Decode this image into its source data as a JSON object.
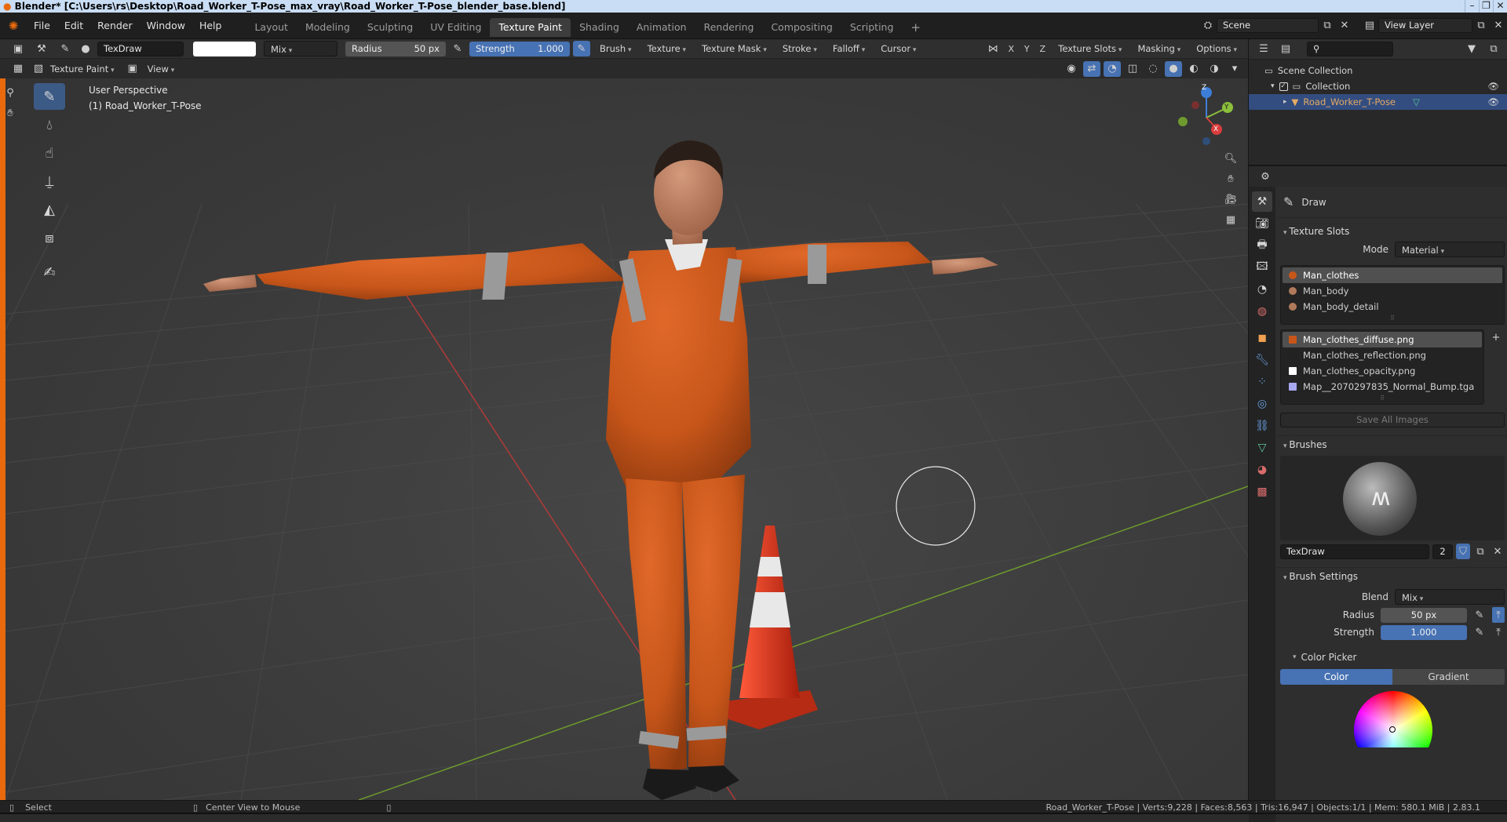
{
  "window": {
    "title": "Blender* [C:\\Users\\rs\\Desktop\\Road_Worker_T-Pose_max_vray\\Road_Worker_T-Pose_blender_base.blend]"
  },
  "menu": [
    "File",
    "Edit",
    "Render",
    "Window",
    "Help"
  ],
  "workspaces": [
    "Layout",
    "Modeling",
    "Sculpting",
    "UV Editing",
    "Texture Paint",
    "Shading",
    "Animation",
    "Rendering",
    "Compositing",
    "Scripting"
  ],
  "active_workspace": "Texture Paint",
  "scene": {
    "label": "Scene",
    "view_layer": "View Layer"
  },
  "toolheader": {
    "brush_name": "TexDraw",
    "blend": "Mix",
    "radius_label": "Radius",
    "radius_value": "50 px",
    "strength_label": "Strength",
    "strength_value": "1.000",
    "menus": [
      "Brush",
      "Texture",
      "Texture Mask",
      "Stroke",
      "Falloff",
      "Cursor"
    ],
    "axes": [
      "X",
      "Y",
      "Z"
    ],
    "right_menus": [
      "Texture Slots",
      "Masking",
      "Options"
    ]
  },
  "viewheader": {
    "mode": "Texture Paint",
    "view": "View"
  },
  "viewport": {
    "perspective": "User Perspective",
    "object": "(1) Road_Worker_T-Pose",
    "gizmo": {
      "x": "X",
      "y": "Y",
      "z": "Z"
    }
  },
  "outliner": {
    "scene_collection": "Scene Collection",
    "collection": "Collection",
    "object": "Road_Worker_T-Pose"
  },
  "properties": {
    "tool": "Draw",
    "texture_slots": {
      "header": "Texture Slots",
      "mode_label": "Mode",
      "mode_value": "Material",
      "materials": [
        "Man_clothes",
        "Man_body",
        "Man_body_detail"
      ],
      "images": [
        "Man_clothes_diffuse.png",
        "Man_clothes_reflection.png",
        "Man_clothes_opacity.png",
        "Map__2070297835_Normal_Bump.tga"
      ],
      "save_all": "Save All Images"
    },
    "brushes": {
      "header": "Brushes",
      "name": "TexDraw",
      "users": "2"
    },
    "brush_settings": {
      "header": "Brush Settings",
      "blend_label": "Blend",
      "blend_value": "Mix",
      "radius_label": "Radius",
      "radius_value": "50 px",
      "strength_label": "Strength",
      "strength_value": "1.000",
      "color_picker": "Color Picker",
      "color_tab": "Color",
      "gradient_tab": "Gradient"
    }
  },
  "status": {
    "select": "Select",
    "center": "Center View to Mouse",
    "stats": "Road_Worker_T-Pose | Verts:9,228 | Faces:8,563 | Tris:16,947 | Objects:1/1 | Mem: 580.1 MiB | 2.83.1"
  },
  "colors": {
    "accent_blue": "#4772b3",
    "tool_orange": "#e86a0c",
    "suit_orange": "#c8561a",
    "cone_red": "#d9381e"
  }
}
